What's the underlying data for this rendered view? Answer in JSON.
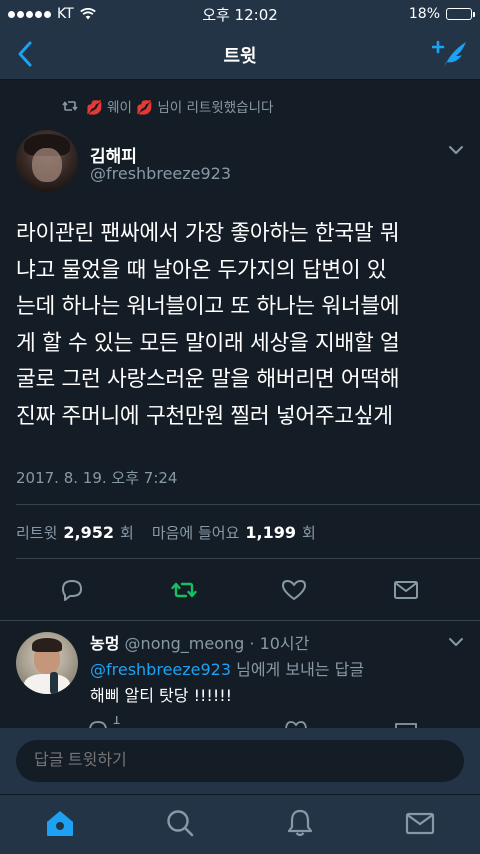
{
  "status_bar": {
    "carrier": "KT",
    "time": "오후 12:02",
    "battery": "18%",
    "battery_level": 0.18
  },
  "nav": {
    "title": "트윗"
  },
  "retweet_context": {
    "text": "💋 웨이 💋 님이 리트윗했습니다"
  },
  "tweet": {
    "author_name": "김해피",
    "author_handle": "@freshbreeze923",
    "body_lines": [
      "라이관린 팬싸에서 가장 좋아하는 한국말 뭐",
      "냐고 물었을 때 날아온 두가지의 답변이 있",
      "는데 하나는 워너블이고 또 하나는 워너블에",
      "게 할 수 있는 모든 말이래 세상을 지배할 얼",
      "굴로 그런 사랑스러운 말을 해버리면 어떡해",
      "진짜 주머니에 구천만원 찔러 넣어주고싶게"
    ],
    "timestamp": "2017. 8. 19. 오후 7:24",
    "stats": {
      "retweets_label": "리트윗",
      "retweets_count": "2,952",
      "retweets_unit": "회",
      "likes_label": "마음에 들어요",
      "likes_count": "1,199",
      "likes_unit": "회"
    }
  },
  "reply": {
    "name": "농멍",
    "handle": "@nong_meong",
    "time": "· 10시간",
    "reply_to_mention": "@freshbreeze923",
    "reply_to_suffix": " 님에게 보내는 답글",
    "text": "해삐 알티 탓당 !!!!!!",
    "reply_count": "1"
  },
  "compose": {
    "placeholder": "답글 트윗하기"
  },
  "colors": {
    "accent": "#1da1f2",
    "retweet_green": "#17bf63",
    "background": "#141d26",
    "bar": "#243447",
    "secondary_text": "#8899a6"
  },
  "icons": {
    "back": "chevron-left-icon",
    "compose": "compose-tweet-icon",
    "reply": "reply-icon",
    "retweet": "retweet-icon",
    "like": "heart-icon",
    "share": "mail-icon",
    "home": "home-icon",
    "search": "search-icon",
    "notifications": "bell-icon",
    "messages": "mail-icon"
  }
}
